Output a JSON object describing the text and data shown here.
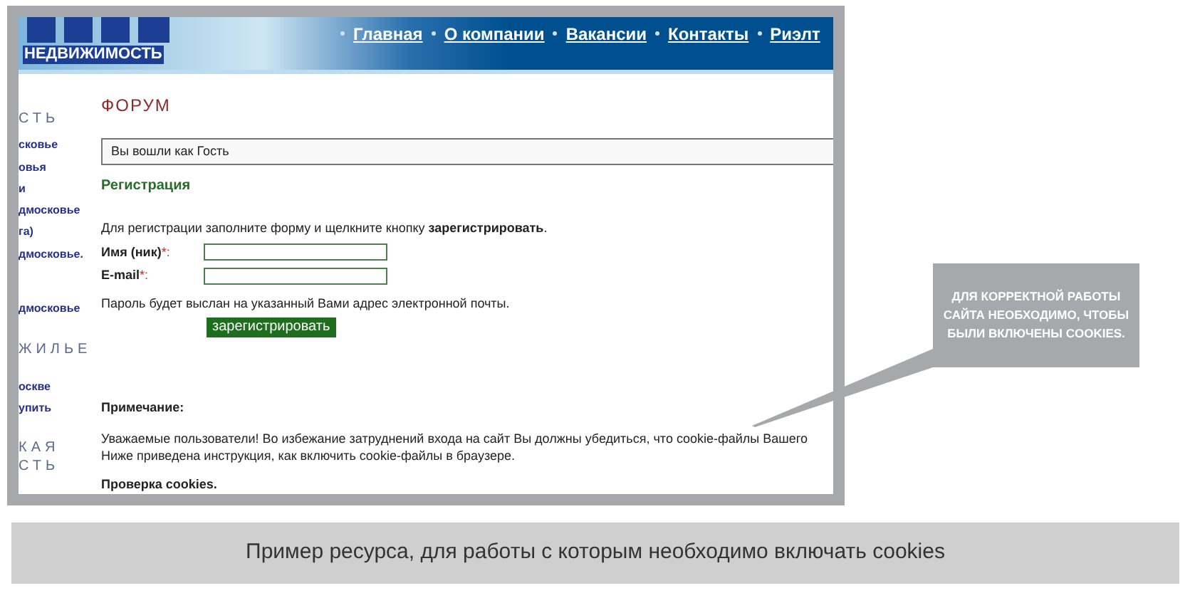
{
  "site": {
    "logo_sub": "НЕДВИЖИМОСТЬ",
    "nav": [
      "Главная",
      "О компании",
      "Вакансии",
      "Контакты",
      "Риэлт"
    ],
    "sidebar": [
      {
        "kind": "heading",
        "label": "СТЬ"
      },
      {
        "kind": "link",
        "label": "сковье"
      },
      {
        "kind": "link",
        "label": "овья"
      },
      {
        "kind": "link",
        "label": "и"
      },
      {
        "kind": "link",
        "label": "дмосковье"
      },
      {
        "kind": "link",
        "label": "га)"
      },
      {
        "kind": "link",
        "label": "дмосковье."
      },
      {
        "kind": "link",
        "label": "дмосковье"
      },
      {
        "kind": "heading",
        "label": "ЖИЛЬЕ"
      },
      {
        "kind": "link",
        "label": "оскве"
      },
      {
        "kind": "link",
        "label": "упить"
      },
      {
        "kind": "heading",
        "label": "КАЯ"
      },
      {
        "kind": "heading",
        "label": "СТЬ"
      }
    ],
    "title": "ФОРУМ",
    "login_status": "Вы вошли как Гость",
    "section": "Регистрация",
    "instruction": "Для регистрации заполните форму и щелкните кнопку **зарегистрировать**.",
    "fields": [
      {
        "label": "Имя (ник)",
        "required": "*:"
      },
      {
        "label": "E-mail",
        "required": "*:"
      }
    ],
    "password_note": "Пароль будет выслан на указанный Вами адрес электронной почты.",
    "register_button": "зарегистрировать",
    "note_title": "Примечание:",
    "note_lines": [
      "Уважаемые пользователи! Во избежание затруднений входа на сайт Вы должны убедиться, что cookie-файлы Вашего",
      "Ниже приведена инструкция, как включить cookie-файлы в браузере."
    ],
    "cookies_check": "Проверка cookies."
  },
  "callout": "ДЛЯ КОРРЕКТНОЙ РАБОТЫ САЙТА НЕОБХОДИМО, ЧТОБЫ БЫЛИ ВКЛЮЧЕНЫ COOKIES.",
  "caption": "Пример ресурса, для работы с которым необходимо включать cookies"
}
